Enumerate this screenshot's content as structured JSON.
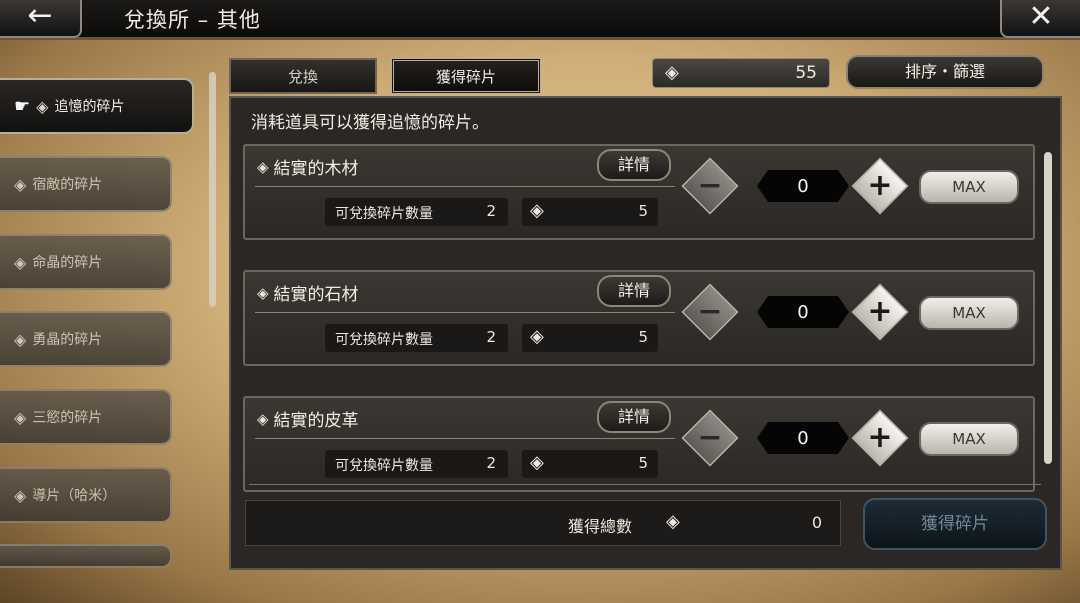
{
  "header": {
    "back_icon": "←",
    "title": "兌換所 – 其他",
    "close_icon": "✕"
  },
  "sidebar": {
    "items": [
      {
        "label": "追憶的碎片",
        "active": true
      },
      {
        "label": "宿敵的碎片"
      },
      {
        "label": "命晶的碎片"
      },
      {
        "label": "勇晶的碎片"
      },
      {
        "label": "三慾的碎片"
      },
      {
        "label": "導片（哈米）"
      }
    ],
    "hand_icon": "☛",
    "diamond_icon": "◈"
  },
  "tabs": [
    {
      "label": "兌換"
    },
    {
      "label": "獲得碎片",
      "active": true
    }
  ],
  "shard_balance": {
    "icon": "◈",
    "value": "55"
  },
  "sort_button": "排序・篩選",
  "info_text": "消耗道具可以獲得追憶的碎片。",
  "items": [
    {
      "name": "結實的木材",
      "detail": "詳情",
      "qty_label": "可兌換碎片數量",
      "qty": "2",
      "cost": "5",
      "count": "0",
      "max": "MAX"
    },
    {
      "name": "結實的石材",
      "detail": "詳情",
      "qty_label": "可兌換碎片數量",
      "qty": "2",
      "cost": "5",
      "count": "0",
      "max": "MAX"
    },
    {
      "name": "結實的皮革",
      "detail": "詳情",
      "qty_label": "可兌換碎片數量",
      "qty": "2",
      "cost": "5",
      "count": "0",
      "max": "MAX"
    }
  ],
  "stepper": {
    "minus": "−",
    "plus": "+"
  },
  "total": {
    "label": "獲得總數",
    "icon": "◈",
    "value": "0"
  },
  "get_button": "獲得碎片"
}
